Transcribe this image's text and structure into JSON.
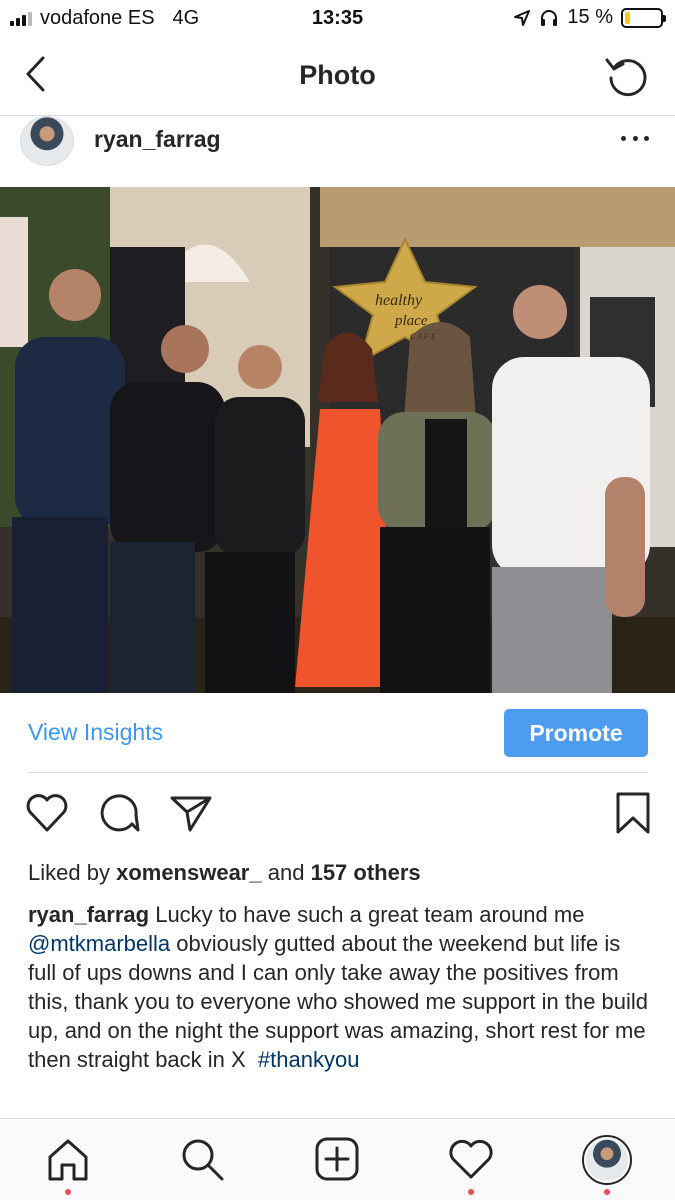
{
  "status_bar": {
    "carrier": "vodafone ES",
    "network": "4G",
    "time": "13:35",
    "battery_percent": "15 %",
    "battery_level": 0.15,
    "icons": [
      "signal-icon",
      "location-icon",
      "headphones-icon",
      "battery-icon"
    ]
  },
  "nav": {
    "title": "Photo",
    "back_icon": "chevron-left-icon",
    "refresh_icon": "refresh-icon"
  },
  "post": {
    "username": "ryan_farrag",
    "more_icon": "more-icon",
    "photo_sign_text": [
      "healthy",
      "place",
      "C A F E"
    ]
  },
  "insights": {
    "view_insights_label": "View Insights",
    "promote_label": "Promote"
  },
  "actions": {
    "icons": [
      "heart-icon",
      "comment-icon",
      "share-icon",
      "bookmark-icon"
    ]
  },
  "likes": {
    "prefix": "Liked by",
    "user": "xomenswear_",
    "middle": "and",
    "others": "157 others"
  },
  "caption": {
    "user": "ryan_farrag",
    "text_1": "Lucky to have such a great team around me",
    "mention": "@mtkmarbella",
    "text_2": "obviously gutted about the weekend but life is full of ups downs and I can only take away the positives from this, thank you to everyone who showed me support in the build up, and on the night the support was amazing, short rest for me then straight back in X",
    "hashtag": "#thankyou"
  },
  "tab_bar": {
    "icons": [
      "home-icon",
      "search-icon",
      "add-icon",
      "activity-icon",
      "profile-avatar"
    ]
  },
  "colors": {
    "accent": "#3897f0",
    "promote_bg": "#4d9cf0",
    "mention": "#003569",
    "notification_dot": "#ed4956",
    "battery_low": "#f5c518"
  }
}
